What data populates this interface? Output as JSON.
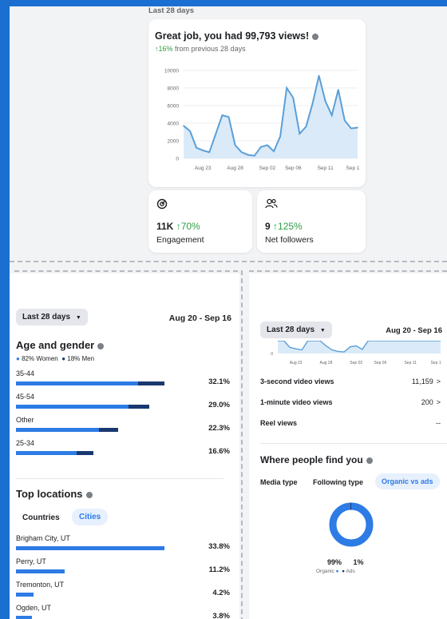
{
  "overview": {
    "period_label": "Last 28 days",
    "headline": "Great job, you had 99,793 views!",
    "change": "↑16%",
    "change_suffix": "from previous 28 days",
    "y_ticks": [
      "10000",
      "8000",
      "6000",
      "4000",
      "2000",
      "0"
    ],
    "x_ticks": [
      "Aug 23",
      "Aug 28",
      "Sep 02",
      "Sep 06",
      "Sep 11",
      "Sep 1"
    ]
  },
  "chart_data": {
    "type": "area",
    "x": [
      "Aug 20",
      "Aug 21",
      "Aug 22",
      "Aug 23",
      "Aug 24",
      "Aug 25",
      "Aug 26",
      "Aug 27",
      "Aug 28",
      "Aug 29",
      "Aug 30",
      "Aug 31",
      "Sep 01",
      "Sep 02",
      "Sep 03",
      "Sep 04",
      "Sep 05",
      "Sep 06",
      "Sep 07",
      "Sep 08",
      "Sep 09",
      "Sep 10",
      "Sep 11",
      "Sep 12",
      "Sep 13",
      "Sep 14",
      "Sep 15",
      "Sep 16"
    ],
    "values": [
      3700,
      3100,
      1200,
      900,
      700,
      2800,
      4900,
      4700,
      1500,
      700,
      400,
      300,
      1300,
      1500,
      800,
      2500,
      8000,
      6900,
      2800,
      3600,
      6200,
      9400,
      6500,
      4900,
      7800,
      4300,
      3400,
      3500
    ],
    "ylim": [
      0,
      10000
    ],
    "grid": true,
    "colors": {
      "line": "#5a9fd8",
      "fill": "#dbeaf8"
    }
  },
  "stats": [
    {
      "icon": "engagement-icon",
      "value": "11K",
      "change": "↑70%",
      "label": "Engagement"
    },
    {
      "icon": "followers-icon",
      "value": "9",
      "change": "↑125%",
      "label": "Net followers"
    }
  ],
  "left_panel": {
    "period_button": "Last 28 days",
    "date_range": "Aug 20 - Sep 16",
    "age_title": "Age and gender",
    "legend_women": "82% Women",
    "legend_men": "18% Men",
    "age_rows": [
      {
        "label": "35-44",
        "pct": "32.1%",
        "women": 0.82,
        "total": 1.0
      },
      {
        "label": "45-54",
        "pct": "29.0%",
        "women": 0.76,
        "total": 0.9
      },
      {
        "label": "Other",
        "pct": "22.3%",
        "women": 0.56,
        "total": 0.69
      },
      {
        "label": "25-34",
        "pct": "16.6%",
        "women": 0.41,
        "total": 0.52
      }
    ],
    "locations_title": "Top locations",
    "tab_countries": "Countries",
    "tab_cities": "Cities",
    "locations": [
      {
        "label": "Brigham City, UT",
        "pct": "33.8%",
        "value": 1.0
      },
      {
        "label": "Perry, UT",
        "pct": "11.2%",
        "value": 0.33
      },
      {
        "label": "Tremonton, UT",
        "pct": "4.2%",
        "value": 0.12
      },
      {
        "label": "Ogden, UT",
        "pct": "3.8%",
        "value": 0.11
      }
    ]
  },
  "right_panel": {
    "period_button": "Last 28 days",
    "date_range": "Aug 20 - Sep 16",
    "mini_ticks": [
      "Aug 23",
      "Aug 28",
      "Sep 02",
      "Sep 06",
      "Sep 11",
      "Sep 1"
    ],
    "mini_zero": "0",
    "metrics": [
      {
        "label": "3-second video views",
        "value": "11,159",
        "chevron": true
      },
      {
        "label": "1-minute video views",
        "value": "200",
        "chevron": true
      },
      {
        "label": "Reel views",
        "value": "--",
        "chevron": false
      }
    ],
    "find_title": "Where people find you",
    "find_tabs": [
      "Media type",
      "Following type",
      "Organic vs ads"
    ],
    "donut": {
      "organic": 0.99,
      "ads": 0.01,
      "organic_color": "#2d7be5",
      "ads_color": "#1a3870"
    },
    "organic_pct": "99%",
    "ads_pct": "1%",
    "organic_label": "Organic",
    "ads_label": "Ads"
  }
}
